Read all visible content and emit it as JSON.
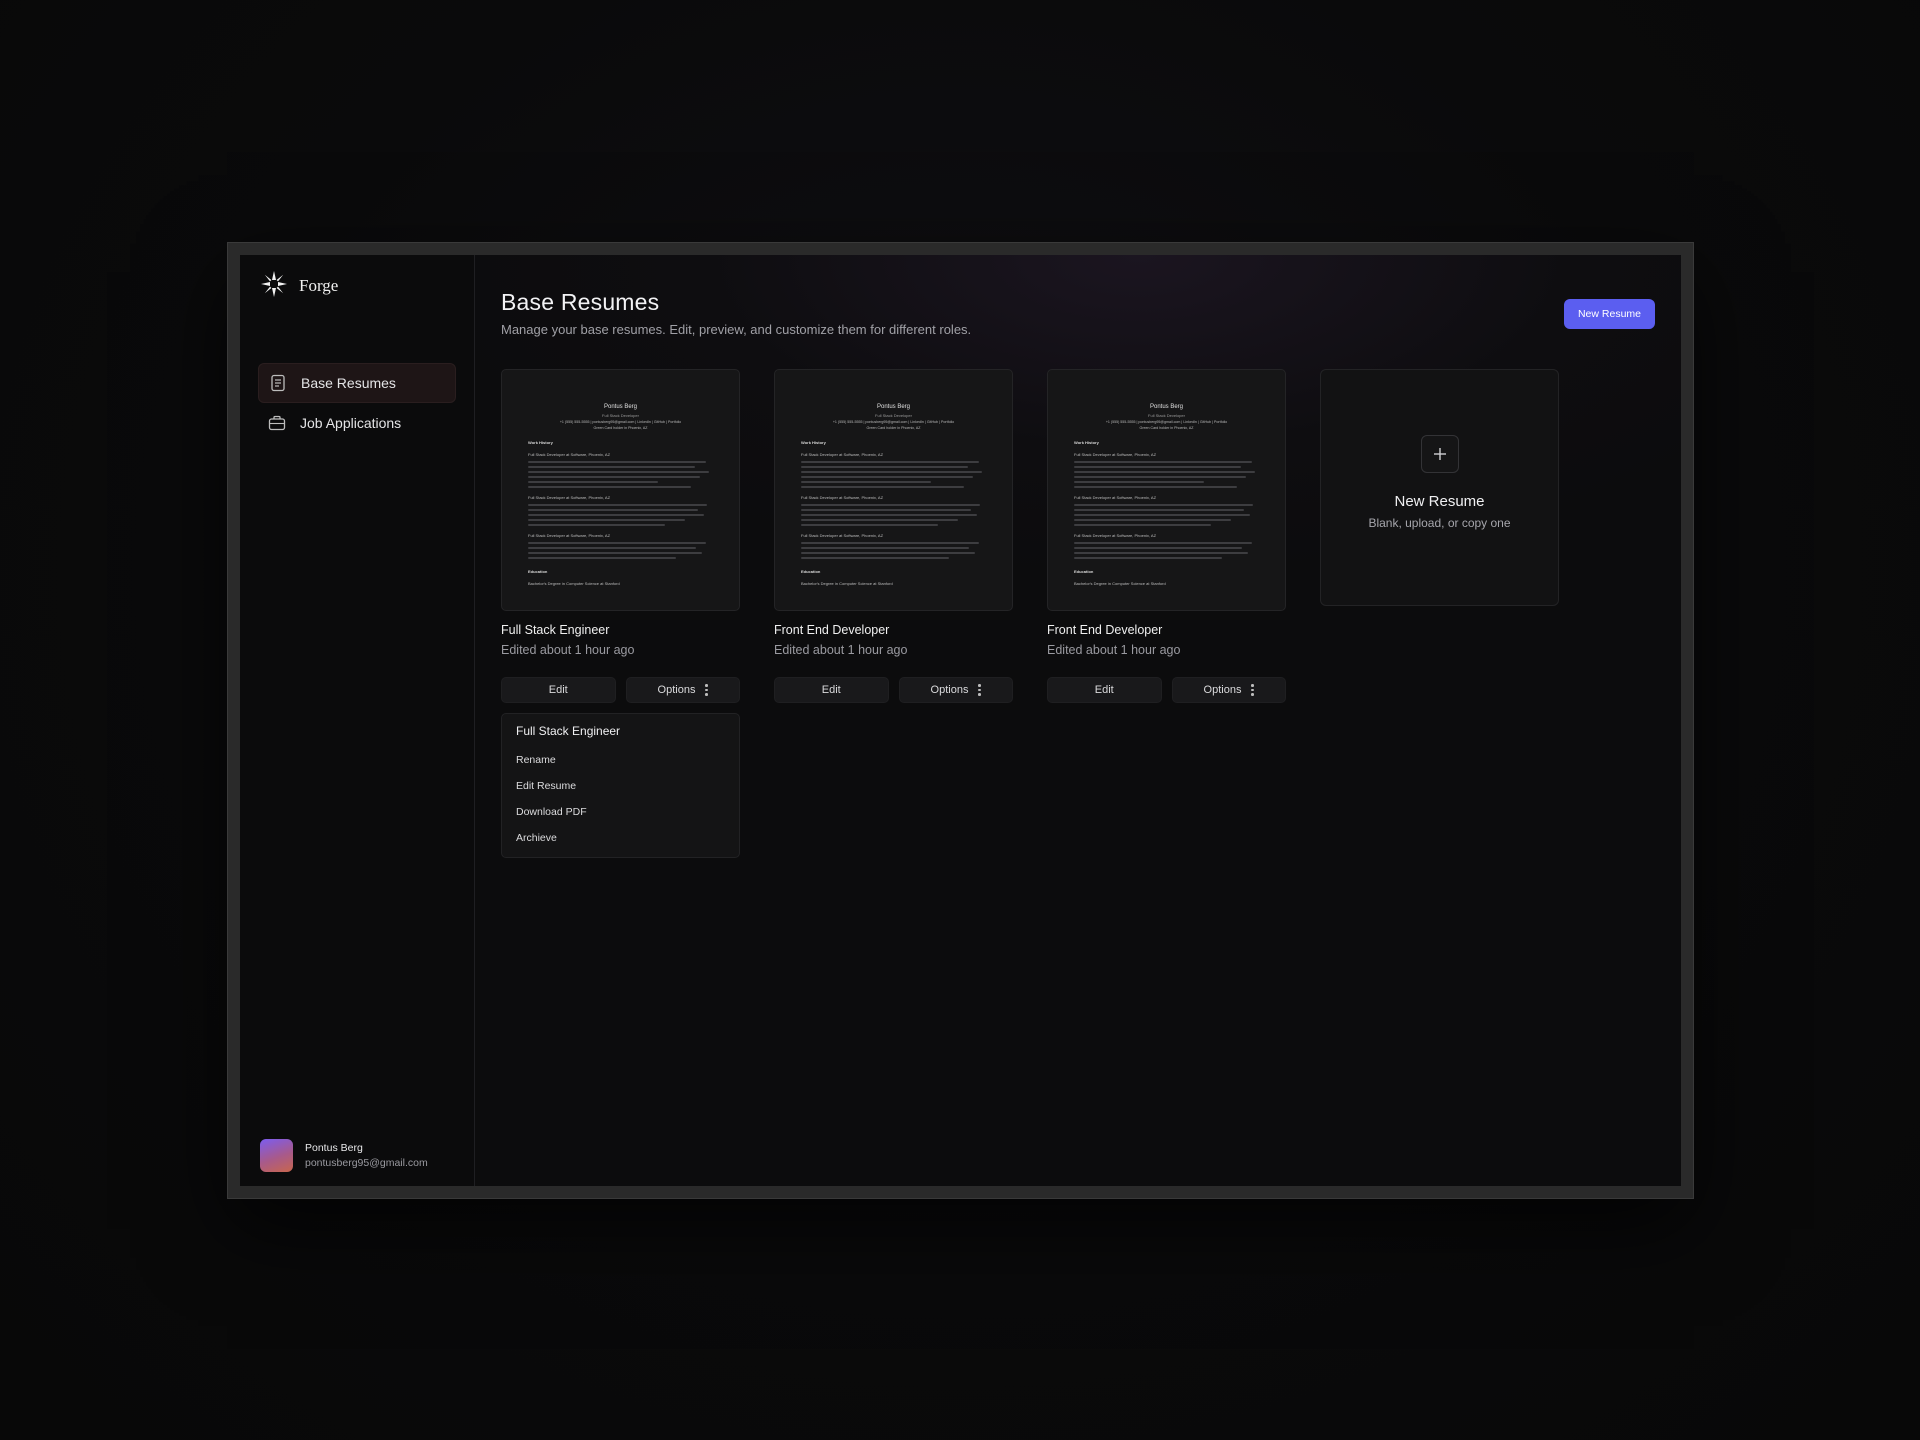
{
  "brand": {
    "name": "Forge"
  },
  "sidebar": {
    "items": [
      {
        "label": "Base Resumes",
        "icon": "document-icon",
        "active": true
      },
      {
        "label": "Job Applications",
        "icon": "briefcase-icon",
        "active": false
      }
    ],
    "user": {
      "name": "Pontus Berg",
      "email": "pontusberg95@gmail.com"
    }
  },
  "header": {
    "title": "Base Resumes",
    "subtitle": "Manage your base resumes. Edit, preview, and customize them for different roles.",
    "new_button": "New Resume"
  },
  "resumes": [
    {
      "title": "Full Stack Engineer",
      "edited": "Edited about 1 hour ago",
      "edit_label": "Edit",
      "options_label": "Options"
    },
    {
      "title": "Front End Developer",
      "edited": "Edited about 1 hour ago",
      "edit_label": "Edit",
      "options_label": "Options"
    },
    {
      "title": "Front End Developer",
      "edited": "Edited about 1 hour ago",
      "edit_label": "Edit",
      "options_label": "Options"
    }
  ],
  "preview": {
    "name": "Pontus Berg",
    "role": "Full Stack Developer",
    "contact": "+1 (555) 555-5555 | pontusberg95@gmail.com | LinkedIn | GitHub | Portfolio",
    "location": "Green Card holder in Phoenix, AZ",
    "section_work": "Work History",
    "job": "Full Stack Developer at Software, Phoenix, AZ",
    "section_edu": "Education",
    "edu": "Bachelor's Degree in Computer Science at Stanford"
  },
  "new_card": {
    "title": "New Resume",
    "subtitle": "Blank, upload, or copy one",
    "icon": "plus-icon"
  },
  "options_menu": {
    "heading": "Full Stack Engineer",
    "items": [
      "Rename",
      "Edit Resume",
      "Download PDF",
      "Archieve"
    ]
  },
  "colors": {
    "accent": "#5b5ef0",
    "background": "#0c0c0d"
  }
}
